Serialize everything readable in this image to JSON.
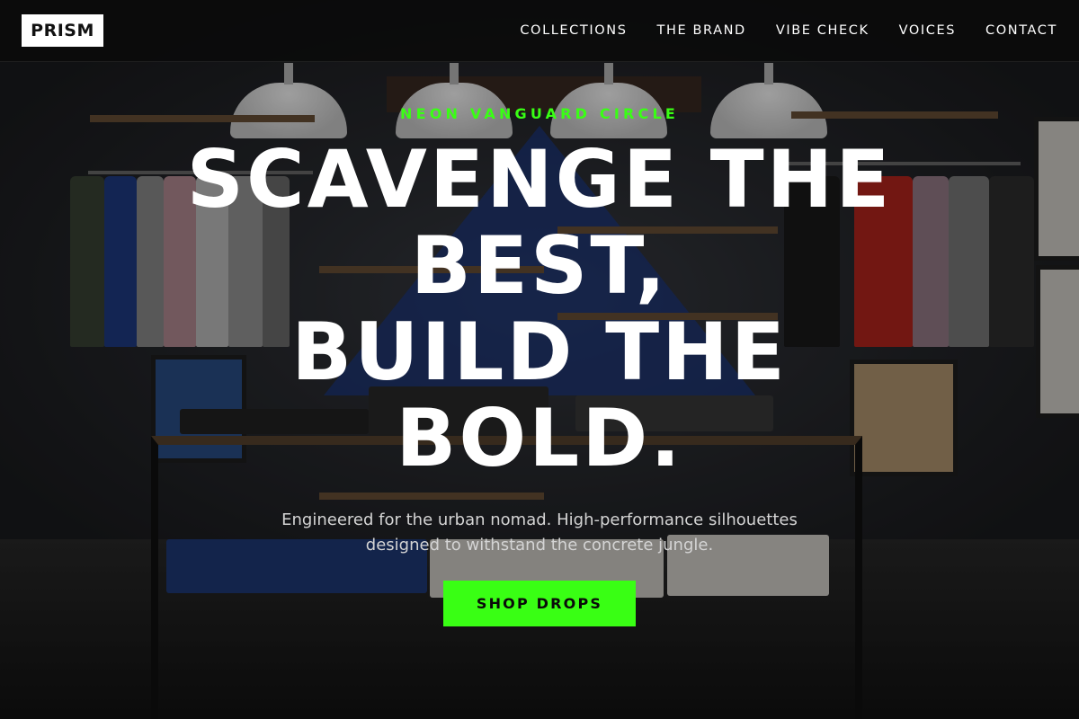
{
  "brand": {
    "logo": "PRISM"
  },
  "nav": {
    "items": [
      {
        "label": "COLLECTIONS"
      },
      {
        "label": "THE BRAND"
      },
      {
        "label": "VIBE CHECK"
      },
      {
        "label": "VOICES"
      },
      {
        "label": "CONTACT"
      }
    ]
  },
  "hero": {
    "eyebrow": "NEON VANGUARD CIRCLE",
    "headline_lines": [
      "SCAVENGE THE",
      "BEST,",
      "BUILD THE",
      "BOLD."
    ],
    "subtitle": "Engineered for the urban nomad. High-performance silhouettes designed to withstand the concrete jungle.",
    "cta_label": "SHOP DROPS",
    "background_image": "clothing-store-interior-photo"
  },
  "colors": {
    "accent": "#39ff14",
    "nav_background": "#0a0a0a",
    "logo_background": "#ffffff",
    "headline": "#ffffff",
    "subtitle": "#d4d4d4"
  }
}
